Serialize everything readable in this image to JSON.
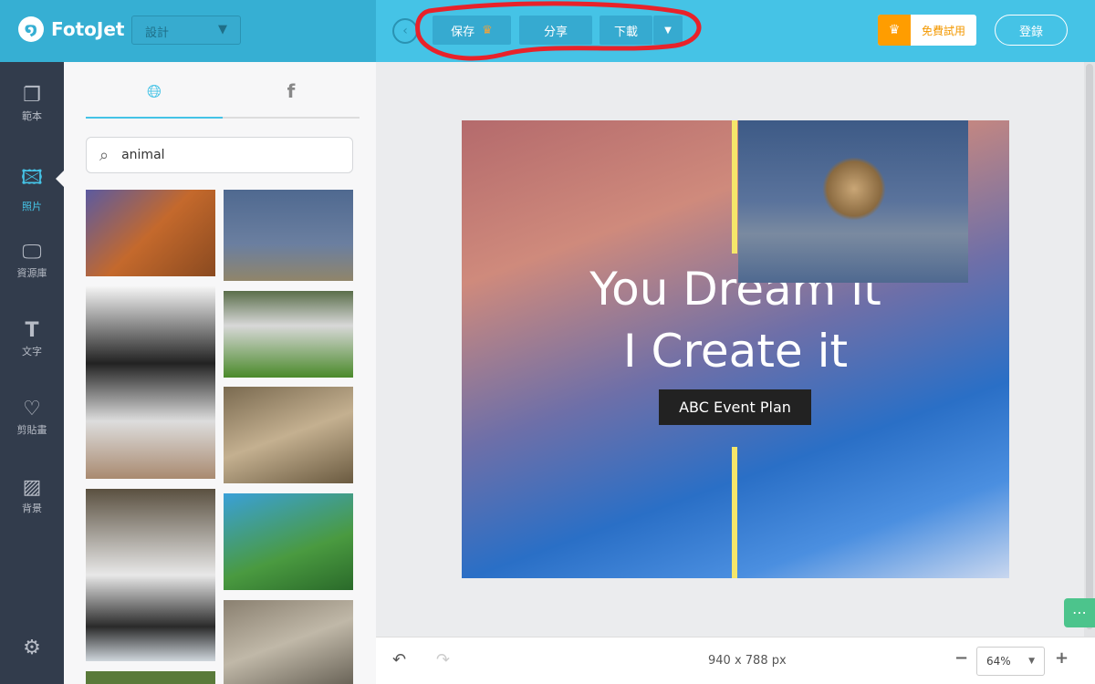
{
  "header": {
    "logo": "FotoJet",
    "mode_select": "設計",
    "save": "保存",
    "share": "分享",
    "download": "下載",
    "trial": "免費試用",
    "login": "登錄"
  },
  "sidebar": {
    "items": [
      {
        "label": "範本",
        "icon": "templates-icon"
      },
      {
        "label": "照片",
        "icon": "photo-icon",
        "active": true
      },
      {
        "label": "資源庫",
        "icon": "library-icon"
      },
      {
        "label": "文字",
        "icon": "text-icon"
      },
      {
        "label": "剪貼畫",
        "icon": "clipart-icon"
      },
      {
        "label": "背景",
        "icon": "background-icon"
      }
    ]
  },
  "panel": {
    "search_value": "animal",
    "tabs": [
      "web",
      "facebook"
    ]
  },
  "design": {
    "line1": "You Dream it",
    "line2": "I Create it",
    "badge": "ABC Event Plan"
  },
  "footer": {
    "size": "940 x 788 px",
    "zoom": "64%"
  },
  "colors": {
    "accent": "#45c3e6",
    "sidebar": "#323c4c",
    "trial": "#ff9d00",
    "annotation": "#e8222a"
  }
}
